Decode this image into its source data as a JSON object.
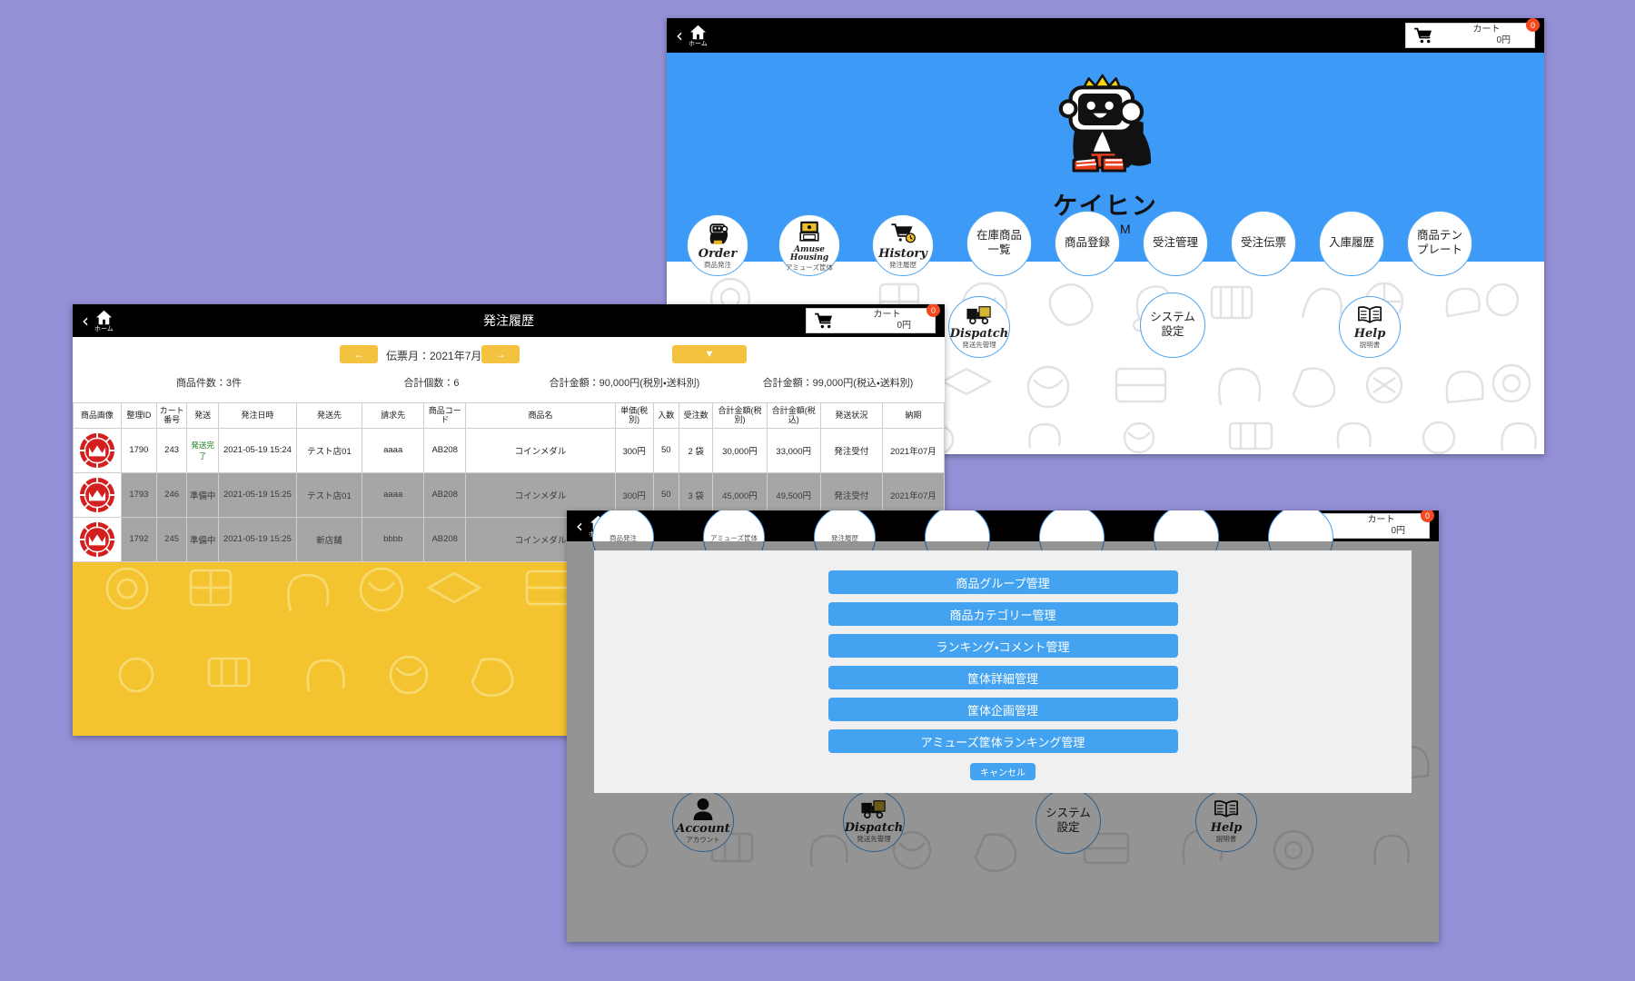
{
  "common": {
    "home_label": "ホーム",
    "back_icon": "chevron-left-icon",
    "cart_label": "カート",
    "cart_amount": "0円",
    "cart_badge": "0",
    "colors": {
      "accent_blue": "#3d9bf7",
      "accent_yellow": "#f4c430",
      "badge_red": "#f4481f",
      "desktop": "#9490d6"
    }
  },
  "home_window": {
    "title": "",
    "logo": {
      "jp": "ケイヒン",
      "en": "FORM"
    },
    "menu_row1": [
      {
        "en": "Order",
        "jp": "商品発注",
        "icon": "robot-penguin-icon"
      },
      {
        "en": "Amuse Housing",
        "jp": "アミューズ筐体",
        "icon": "arcade-cabinet-icon"
      },
      {
        "en": "History",
        "jp": "発注履歴",
        "icon": "cart-clock-icon"
      },
      {
        "main": "在庫商品一覧"
      },
      {
        "main": "商品登録"
      },
      {
        "main": "受注管理"
      },
      {
        "main": "受注伝票"
      },
      {
        "main": "入庫履歴"
      },
      {
        "main": "商品テンプレート"
      }
    ],
    "menu_row2": [
      {
        "en": "Dispatch",
        "jp": "発送先管理",
        "icon": "truck-icon"
      },
      {
        "main": "システム設定"
      },
      {
        "en": "Help",
        "jp": "説明書",
        "icon": "book-icon"
      }
    ]
  },
  "history_window": {
    "title": "発注履歴",
    "nav": {
      "prev": "←",
      "next": "→",
      "period_label": "伝票月：2021年7月",
      "filter": "▼"
    },
    "stats": [
      "商品件数：3件",
      "合計個数：6",
      "合計金額：90,000円(税別・送料別)",
      "合計金額：99,000円(税込・送料別)"
    ],
    "columns": [
      "商品画像",
      "整理ID",
      "カート番号",
      "発送",
      "発注日時",
      "発送先",
      "請求先",
      "商品コード",
      "商品名",
      "単価(税別)",
      "入数",
      "受注数",
      "合計金額(税別)",
      "合計金額(税込)",
      "発送状況",
      "納期"
    ],
    "rows": [
      {
        "dim": false,
        "image": "medal-icon",
        "id": "1790",
        "cart_no": "243",
        "ship": "発送完了",
        "ship_green": true,
        "order_date": "2021-05-19 15:24",
        "ship_to": "テスト店01",
        "bill_to": "aaaa",
        "code": "AB208",
        "name": "コインメダル",
        "unit_price": "300円",
        "qty_per": "50",
        "order_qty": "2 袋",
        "total_ex": "30,000円",
        "total_in": "33,000円",
        "status": "発注受付",
        "due": "2021年07月"
      },
      {
        "dim": true,
        "image": "medal-icon",
        "id": "1793",
        "cart_no": "246",
        "ship": "準備中",
        "ship_green": false,
        "order_date": "2021-05-19 15:25",
        "ship_to": "テスト店01",
        "bill_to": "aaaa",
        "code": "AB208",
        "name": "コインメダル",
        "unit_price": "300円",
        "qty_per": "50",
        "order_qty": "3 袋",
        "total_ex": "45,000円",
        "total_in": "49,500円",
        "status": "発注受付",
        "due": "2021年07月"
      },
      {
        "dim": true,
        "image": "medal-icon",
        "id": "1792",
        "cart_no": "245",
        "ship": "準備中",
        "ship_green": false,
        "order_date": "2021-05-19 15:25",
        "ship_to": "新店舗",
        "bill_to": "bbbb",
        "code": "AB208",
        "name": "コインメダル",
        "unit_price": "",
        "qty_per": "",
        "order_qty": "",
        "total_ex": "",
        "total_in": "",
        "status": "",
        "due": ""
      }
    ]
  },
  "settings_window": {
    "title": "",
    "modal": {
      "buttons": [
        "商品グループ管理",
        "商品カテゴリー管理",
        "ランキング・コメント管理",
        "筐体詳細管理",
        "筐体企画管理",
        "アミューズ筐体ランキング管理"
      ],
      "cancel": "キャンセル"
    },
    "menu_row2": [
      {
        "en": "Account",
        "jp": "アカウント",
        "icon": "person-icon"
      },
      {
        "en": "Dispatch",
        "jp": "発送先管理",
        "icon": "truck-icon"
      },
      {
        "main": "システム設定"
      },
      {
        "en": "Help",
        "jp": "説明書",
        "icon": "book-icon"
      }
    ]
  }
}
